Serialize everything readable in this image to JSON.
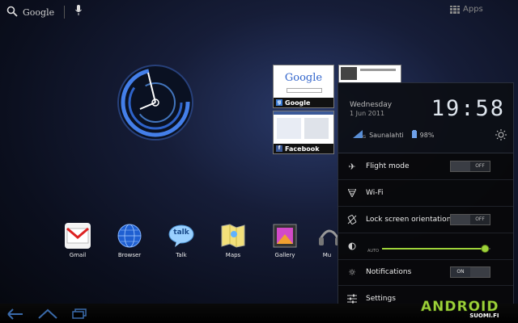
{
  "top_bar": {
    "search_label": "Google",
    "apps_label": "Apps"
  },
  "thumbnails": [
    {
      "title": "Google",
      "site_text": "Google"
    },
    {
      "title": "Facebook"
    }
  ],
  "dock": [
    {
      "label": "Gmail"
    },
    {
      "label": "Browser"
    },
    {
      "label": "Talk",
      "icon_text": "talk"
    },
    {
      "label": "Maps"
    },
    {
      "label": "Gallery"
    },
    {
      "label": "Mu"
    }
  ],
  "status": {
    "day": "Wednesday",
    "date": "1 Jun 2011",
    "time": "19:58",
    "network": "Saunalahti",
    "signal": "3G",
    "battery": "98%"
  },
  "quick_settings": {
    "flight_mode": {
      "label": "Flight mode",
      "state": "OFF"
    },
    "wifi": {
      "label": "Wi-Fi"
    },
    "lock_orientation": {
      "label": "Lock screen orientation",
      "state": "OFF"
    },
    "brightness": {
      "auto_label": "AUTO",
      "level": 0.95
    },
    "notifications": {
      "label": "Notifications",
      "state": "ON"
    },
    "settings": {
      "label": "Settings"
    }
  },
  "watermark": {
    "brand": "ANDROID",
    "sub": "SUOMI.FI"
  },
  "colors": {
    "accent": "#9ed33a",
    "clock_blue": "#4a8cff"
  }
}
